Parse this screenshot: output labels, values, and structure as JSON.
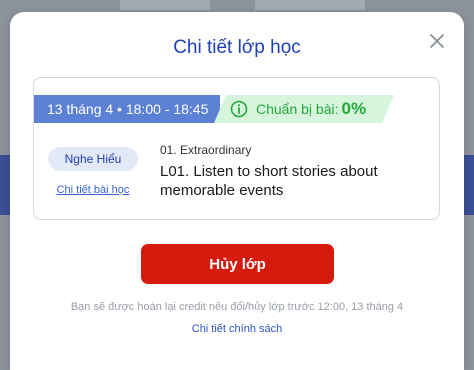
{
  "modal": {
    "title": "Chi tiết lớp học",
    "close_icon": "close-icon"
  },
  "class_card": {
    "datetime": "13 tháng 4 • 18:00 - 18:45",
    "prep_icon": "info-circle-icon",
    "prep_label": "Chuẩn bị bài:",
    "prep_value": "0%",
    "skill_tag": "Nghe Hiểu",
    "lesson_detail_link": "Chi tiết bài học",
    "unit_name": "01. Extraordinary",
    "lesson_title": "L01. Listen to short stories about memorable events"
  },
  "actions": {
    "cancel_label": "Hủy lớp",
    "refund_note": "Bạn sẽ được hoàn lại credit nếu đổi/hủy lớp trước 12:00, 13 tháng 4",
    "policy_link": "Chi tiết chính sách"
  },
  "colors": {
    "title_blue": "#1f3fb4",
    "time_badge_bg": "#5b80d4",
    "prep_badge_bg": "#d6f5dc",
    "prep_green": "#24a83a",
    "cancel_red": "#d51c0c"
  }
}
